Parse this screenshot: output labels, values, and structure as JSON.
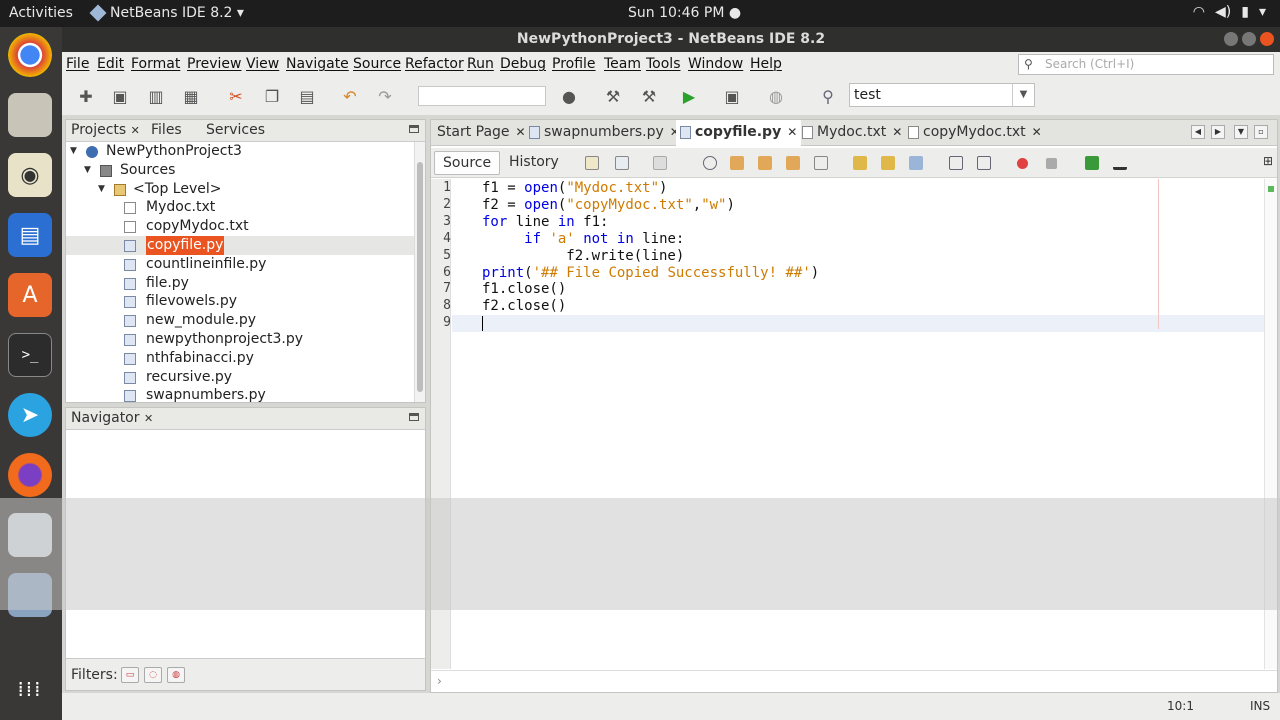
{
  "system_bar": {
    "activities": "Activities",
    "app_menu": "NetBeans IDE 8.2 ▾",
    "clock": "Sun 10:46 PM ●",
    "tray": [
      "wifi-icon",
      "volume-icon",
      "battery-icon",
      "power-menu-icon"
    ]
  },
  "dock": {
    "apps": [
      "chrome-icon",
      "files-icon",
      "rhythmbox-icon",
      "writer-icon",
      "software-icon",
      "terminal-icon",
      "telegram-icon",
      "firefox-icon",
      "netbeans-icon",
      "other-app-icon",
      "show-apps-icon"
    ]
  },
  "window": {
    "title": "NewPythonProject3 - NetBeans IDE 8.2"
  },
  "menu": {
    "items": [
      "File",
      "Edit",
      "Format",
      "Preview",
      "View",
      "Navigate",
      "Source",
      "Refactor",
      "Run",
      "Debug",
      "Profile",
      "Team",
      "Tools",
      "Window",
      "Help"
    ],
    "search_placeholder": "Search (Ctrl+I)"
  },
  "toolbar": {
    "config_value": "",
    "run_target": "test"
  },
  "projects_panel": {
    "tabs": [
      "Projects",
      "Files",
      "Services"
    ],
    "tree": [
      {
        "label": "NewPythonProject3",
        "level": 0,
        "icon": "project"
      },
      {
        "label": "Sources",
        "level": 1,
        "icon": "sources"
      },
      {
        "label": "<Top Level>",
        "level": 2,
        "icon": "package"
      },
      {
        "label": "Mydoc.txt",
        "level": 3,
        "icon": "txt"
      },
      {
        "label": "copyMydoc.txt",
        "level": 3,
        "icon": "txt"
      },
      {
        "label": "copyfile.py",
        "level": 3,
        "icon": "py",
        "selected": true
      },
      {
        "label": "countlineinfile.py",
        "level": 3,
        "icon": "py"
      },
      {
        "label": "file.py",
        "level": 3,
        "icon": "py"
      },
      {
        "label": "filevowels.py",
        "level": 3,
        "icon": "py"
      },
      {
        "label": "new_module.py",
        "level": 3,
        "icon": "py"
      },
      {
        "label": "newpythonproject3.py",
        "level": 3,
        "icon": "py"
      },
      {
        "label": "nthfabinacci.py",
        "level": 3,
        "icon": "py"
      },
      {
        "label": "recursive.py",
        "level": 3,
        "icon": "py"
      },
      {
        "label": "swapnumbers.py",
        "level": 3,
        "icon": "py"
      }
    ]
  },
  "navigator_panel": {
    "title": "Navigator",
    "filters_label": "Filters:"
  },
  "editor": {
    "tabs": [
      {
        "label": "Start Page",
        "icon": "none"
      },
      {
        "label": "swapnumbers.py",
        "icon": "py"
      },
      {
        "label": "copyfile.py",
        "icon": "py",
        "active": true
      },
      {
        "label": "Mydoc.txt",
        "icon": "txt"
      },
      {
        "label": "copyMydoc.txt",
        "icon": "txt"
      }
    ],
    "modes": [
      "Source",
      "History"
    ],
    "lines": [
      [
        [
          "",
          "f1 = "
        ],
        [
          "kw",
          "open"
        ],
        [
          "",
          "("
        ],
        [
          "str",
          "\"Mydoc.txt\""
        ],
        [
          "",
          ")"
        ]
      ],
      [
        [
          "",
          "f2 = "
        ],
        [
          "kw",
          "open"
        ],
        [
          "",
          "("
        ],
        [
          "str",
          "\"copyMydoc.txt\""
        ],
        [
          "",
          ","
        ],
        [
          "str",
          "\"w\""
        ],
        [
          "",
          ")"
        ]
      ],
      [
        [
          "kw",
          "for"
        ],
        [
          "",
          " line "
        ],
        [
          "kw",
          "in"
        ],
        [
          "",
          " f1:"
        ]
      ],
      [
        [
          "",
          "     "
        ],
        [
          "kw",
          "if"
        ],
        [
          "",
          " "
        ],
        [
          "str",
          "'a'"
        ],
        [
          "",
          " "
        ],
        [
          "kw",
          "not"
        ],
        [
          "",
          " "
        ],
        [
          "kw",
          "in"
        ],
        [
          "",
          " line:"
        ]
      ],
      [
        [
          "",
          "          f2.write(line)"
        ]
      ],
      [
        [
          "kw",
          "print"
        ],
        [
          "",
          "("
        ],
        [
          "str",
          "'## File Copied Successfully! ##'"
        ],
        [
          "",
          ")"
        ]
      ],
      [
        [
          "",
          "f1.close()"
        ]
      ],
      [
        [
          "",
          "f2.close()"
        ]
      ],
      [
        [
          "",
          ""
        ]
      ]
    ],
    "current_line": 9
  },
  "status": {
    "position": "10:1",
    "mode": "INS"
  }
}
